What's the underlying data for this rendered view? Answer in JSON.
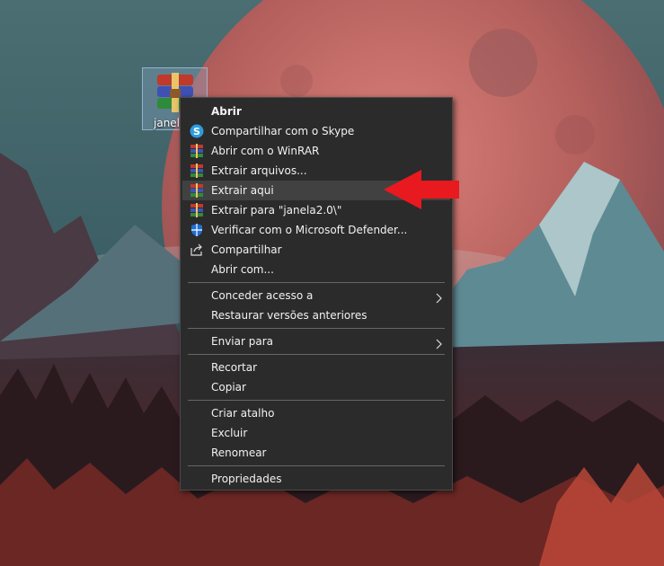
{
  "desktop": {
    "icon": {
      "label": "janela",
      "icon_name": "winrar-archive-icon"
    }
  },
  "context_menu": {
    "highlighted_item": "Extrair aqui",
    "groups": [
      [
        {
          "label": "Abrir",
          "bold": true,
          "icon": null
        },
        {
          "label": "Compartilhar com o Skype",
          "icon": "skype-icon"
        },
        {
          "label": "Abrir com o WinRAR",
          "icon": "winrar-icon"
        },
        {
          "label": "Extrair arquivos...",
          "icon": "winrar-icon"
        },
        {
          "label": "Extrair aqui",
          "icon": "winrar-icon"
        },
        {
          "label": "Extrair para \"janela2.0\\\"",
          "icon": "winrar-icon"
        },
        {
          "label": "Verificar com o Microsoft Defender...",
          "icon": "defender-shield-icon"
        },
        {
          "label": "Compartilhar",
          "icon": "share-icon"
        },
        {
          "label": "Abrir com...",
          "icon": null
        }
      ],
      [
        {
          "label": "Conceder acesso a",
          "submenu": true
        },
        {
          "label": "Restaurar versões anteriores"
        }
      ],
      [
        {
          "label": "Enviar para",
          "submenu": true
        }
      ],
      [
        {
          "label": "Recortar"
        },
        {
          "label": "Copiar"
        }
      ],
      [
        {
          "label": "Criar atalho"
        },
        {
          "label": "Excluir"
        },
        {
          "label": "Renomear"
        }
      ],
      [
        {
          "label": "Propriedades"
        }
      ]
    ]
  },
  "annotation": {
    "icon": "red-arrow-icon",
    "color": "#e8191f"
  },
  "colors": {
    "menu_bg": "#2b2b2b",
    "menu_hover": "#414141",
    "menu_text": "#f2f2f2"
  }
}
